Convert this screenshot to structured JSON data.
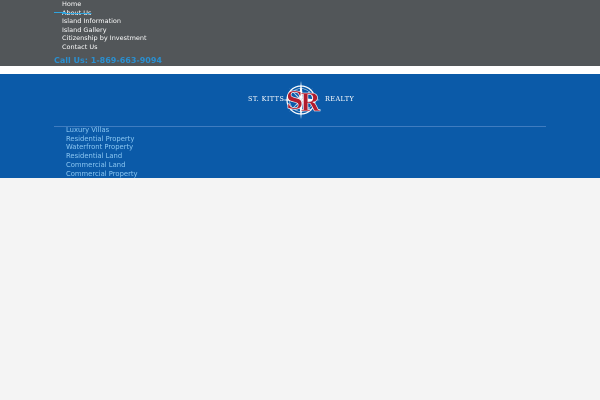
{
  "top_nav": {
    "items": [
      {
        "label": "Home"
      },
      {
        "label": "About Us"
      },
      {
        "label": "Island Information"
      },
      {
        "label": "Island Gallery"
      },
      {
        "label": "Citizenship by Investment"
      },
      {
        "label": "Contact Us"
      }
    ],
    "current_index": 1,
    "call_us": "Call Us: 1-869-663-9094"
  },
  "logo": {
    "left_text": "ST. KITTS",
    "right_text": "REALTY",
    "monogram_s": "S",
    "monogram_r": "R"
  },
  "sub_nav": {
    "items": [
      {
        "label": "Luxury Villas"
      },
      {
        "label": "Residential Property"
      },
      {
        "label": "Waterfront Property"
      },
      {
        "label": "Residential Land"
      },
      {
        "label": "Commercial Land"
      },
      {
        "label": "Commercial Property"
      }
    ]
  },
  "colors": {
    "top_bar": "#525659",
    "brand_blue": "#0b5aa8",
    "accent": "#2a8fd0",
    "logo_red": "#b01c2e",
    "page_bg": "#f4f4f4"
  }
}
